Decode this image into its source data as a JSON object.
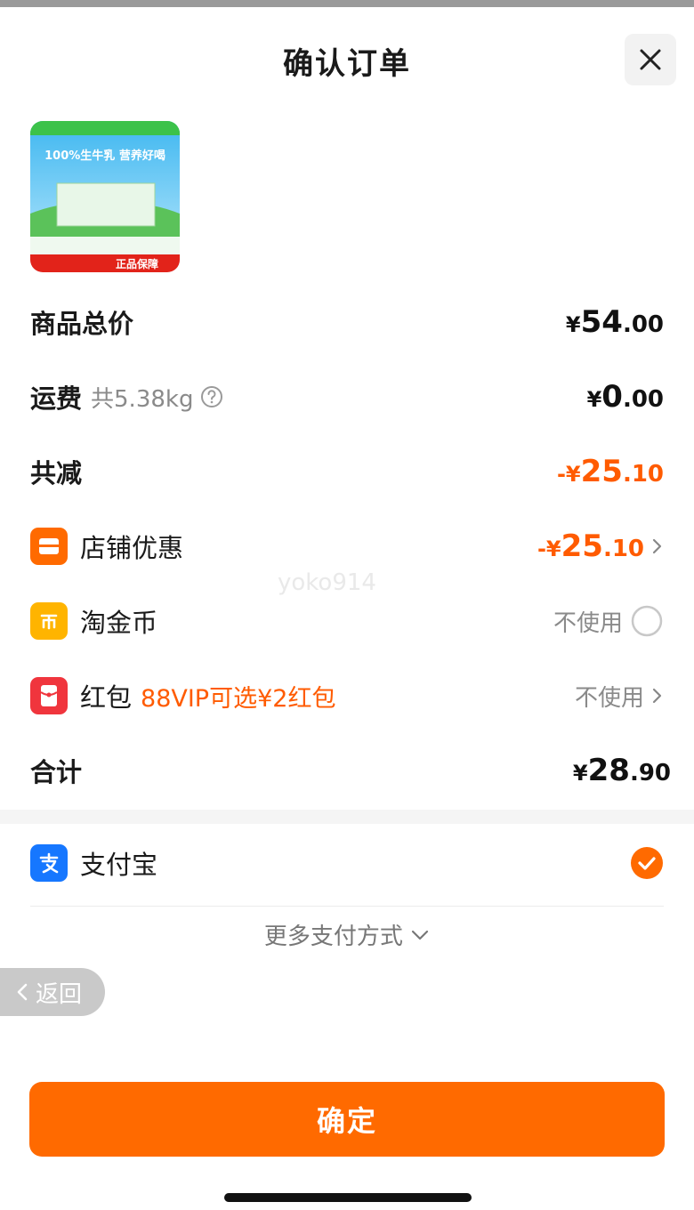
{
  "header": {
    "title": "确认订单"
  },
  "product": {
    "thumbnail_badge": "正品保障",
    "thumbnail_headline": "100%生牛乳 营养好喝"
  },
  "summary": {
    "goods_total": {
      "label": "商品总价",
      "currency": "¥",
      "int": "54",
      "dec": ".00"
    },
    "shipping": {
      "label": "运费",
      "weight": "共5.38kg",
      "currency": "¥",
      "int": "0",
      "dec": ".00"
    },
    "discount_total": {
      "label": "共减",
      "prefix": "-¥",
      "int": "25",
      "dec": ".10"
    },
    "store_coupon": {
      "label": "店铺优惠",
      "prefix": "-¥",
      "int": "25",
      "dec": ".10"
    },
    "gold_coins": {
      "label": "淘金币",
      "value": "不使用"
    },
    "red_packet": {
      "label": "红包",
      "promo": "88VIP可选¥2红包",
      "value": "不使用"
    },
    "grand_total": {
      "label": "合计",
      "currency": "¥",
      "int": "28",
      "dec": ".90"
    }
  },
  "payment": {
    "method": "支付宝",
    "more_label": "更多支付方式"
  },
  "back": {
    "label": "返回"
  },
  "confirm": {
    "label": "确定"
  },
  "watermark": "yoko914",
  "colors": {
    "accent": "#ff6a00",
    "discount": "#ff5b00",
    "alipay": "#1677ff"
  }
}
